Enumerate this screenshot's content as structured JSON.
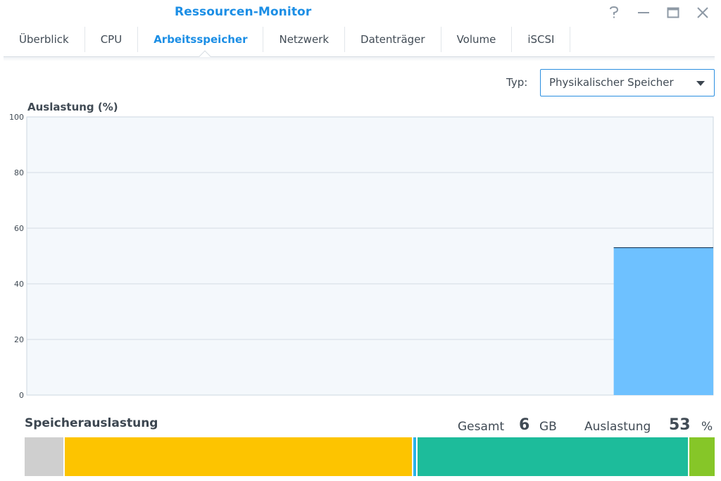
{
  "window": {
    "title": "Ressourcen-Monitor",
    "controls": [
      "help-icon",
      "minimize-icon",
      "maximize-icon",
      "close-icon"
    ]
  },
  "tabs": [
    {
      "label": "Überblick",
      "active": false
    },
    {
      "label": "CPU",
      "active": false
    },
    {
      "label": "Arbeitsspeicher",
      "active": true
    },
    {
      "label": "Netzwerk",
      "active": false
    },
    {
      "label": "Datenträger",
      "active": false
    },
    {
      "label": "Volume",
      "active": false
    },
    {
      "label": "iSCSI",
      "active": false
    }
  ],
  "type_selector": {
    "label": "Typ:",
    "value": "Physikalischer Speicher"
  },
  "chart_data": {
    "type": "area",
    "title": "Auslastung (%)",
    "ylim": [
      0,
      100
    ],
    "yticks": [
      0,
      20,
      40,
      60,
      80,
      100
    ],
    "grid": true,
    "x_fraction_start": 0.855,
    "values": [
      53
    ],
    "fill_color": "#6ec1ff",
    "line_color": "#2e4a66"
  },
  "memory": {
    "title": "Speicherauslastung",
    "total_label": "Gesamt",
    "total_value": "6",
    "total_unit": "GB",
    "usage_label": "Auslastung",
    "usage_value": "53",
    "usage_unit": "%",
    "segments": [
      {
        "name": "reserved",
        "fraction": 0.058,
        "color": "#cfcfcf"
      },
      {
        "name": "used",
        "fraction": 0.505,
        "color": "#fdc400"
      },
      {
        "name": "buffer",
        "fraction": 0.006,
        "color": "#2bb3e8"
      },
      {
        "name": "cache",
        "fraction": 0.394,
        "color": "#1dbc9b"
      },
      {
        "name": "free",
        "fraction": 0.037,
        "color": "#86c628"
      }
    ]
  },
  "colors": {
    "accent": "#1b8ee5",
    "text": "#414b55"
  }
}
